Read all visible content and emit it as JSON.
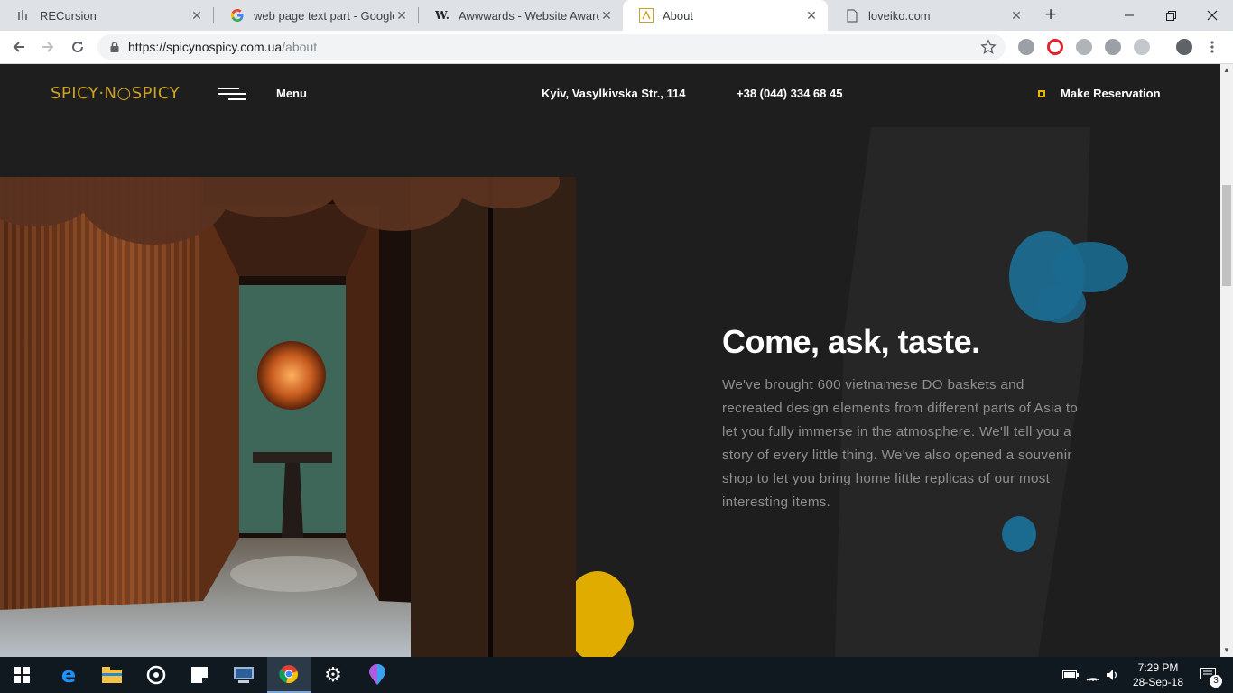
{
  "browser": {
    "tabs": [
      {
        "title": "RECursion",
        "favicon": "bars-favicon"
      },
      {
        "title": "web page text part - Google S",
        "favicon": "google-favicon"
      },
      {
        "title": "Awwwards - Website Awards -",
        "favicon": "awwwards-favicon"
      },
      {
        "title": "About",
        "favicon": "spicy-favicon"
      },
      {
        "title": "loveiko.com",
        "favicon": "page-favicon"
      }
    ],
    "url_host": "https://spicynospicy.com.ua",
    "url_path": "/about"
  },
  "site": {
    "logo": "SPICY·N○SPICY",
    "menu_label": "Menu",
    "address": "Kyiv, Vasylkivska Str., 114",
    "phone": "+38 (044) 334 68 45",
    "reservation": "Make Reservation",
    "section_title": "Come, ask, taste.",
    "section_text": "We've brought 600 vietnamese DO baskets and recreated design elements from different parts of Asia to let you fully immerse in the atmosphere. We'll tell you a story of every little thing. We've also opened a souvenir shop to let you bring home little replicas of our most interesting items.",
    "colors": {
      "accent_gold": "#c9a227",
      "accent_yellow": "#e8b800",
      "blob_blue": "#1b6a8f",
      "background": "#1e1e1e"
    }
  },
  "taskbar": {
    "time": "7:29 PM",
    "date": "28-Sep-18",
    "notifications": "3"
  }
}
